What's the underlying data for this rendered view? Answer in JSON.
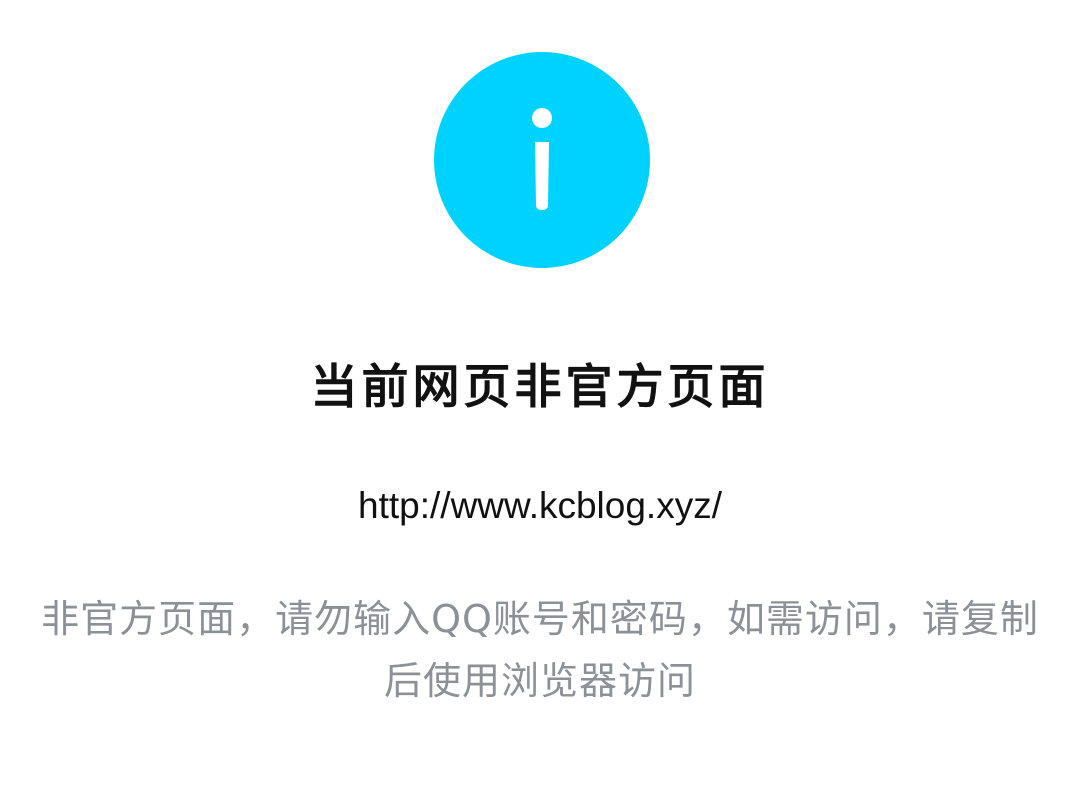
{
  "icon": {
    "name": "info-icon",
    "color": "#00d2ff"
  },
  "title": "当前网页非官方页面",
  "url": "http://www.kcblog.xyz/",
  "warning": "非官方页面，请勿输入QQ账号和密码，如需访问，请复制后使用浏览器访问"
}
